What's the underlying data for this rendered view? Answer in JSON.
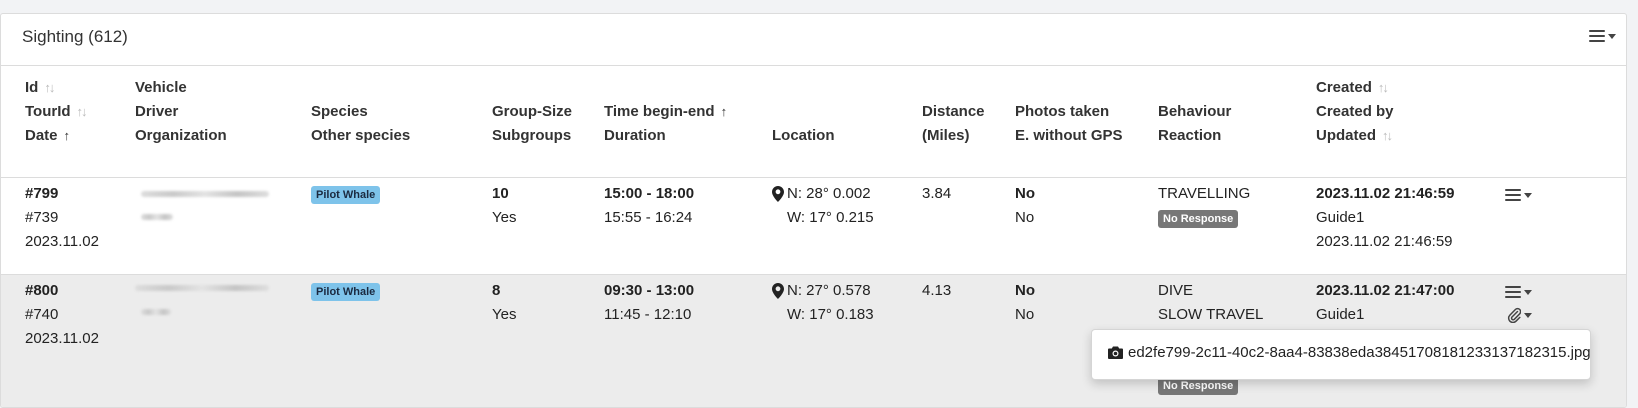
{
  "panel": {
    "title": "Sighting (612)"
  },
  "columns": {
    "id": "Id",
    "tourid": "TourId",
    "date": "Date",
    "vehicle": "Vehicle",
    "driver": "Driver",
    "organization": "Organization",
    "species": "Species",
    "other_species": "Other species",
    "group_size": "Group-Size",
    "subgroups": "Subgroups",
    "time": "Time begin-end",
    "duration": "Duration",
    "location": "Location",
    "distance": "Distance",
    "distance_unit": "(Miles)",
    "photos": "Photos taken",
    "no_gps": "E. without GPS",
    "behaviour": "Behaviour",
    "reaction": "Reaction",
    "created": "Created",
    "created_by": "Created by",
    "updated": "Updated"
  },
  "rows": [
    {
      "id": "#799",
      "tourid": "#739",
      "date": "2023.11.02",
      "species": "Pilot Whale",
      "group_size": "10",
      "subgroups": "Yes",
      "time": "15:00 - 18:00",
      "duration": "15:55 - 16:24",
      "lat": "N: 28° 0.002",
      "lon": "W: 17° 0.215",
      "distance": "3.84",
      "photos": "No",
      "no_gps": "No",
      "behaviour": "TRAVELLING",
      "reaction": "No Response",
      "created": "2023.11.02 21:46:59",
      "created_by": "Guide1",
      "updated": "2023.11.02 21:46:59"
    },
    {
      "id": "#800",
      "tourid": "#740",
      "date": "2023.11.02",
      "species": "Pilot Whale",
      "group_size": "8",
      "subgroups": "Yes",
      "time": "09:30 - 13:00",
      "duration": "11:45 - 12:10",
      "lat": "N: 27° 0.578",
      "lon": "W: 17° 0.183",
      "distance": "4.13",
      "photos": "No",
      "no_gps": "No",
      "behaviour": "DIVE",
      "behaviour2": "SLOW TRAVEL",
      "reaction": "No Response",
      "created": "2023.11.02 21:47:00",
      "created_by": "Guide1"
    }
  ],
  "attachment_popup": {
    "filename": "ed2fe799-2c11-40c2-8aa4-83838eda384517081812331371823​15.jpg"
  }
}
